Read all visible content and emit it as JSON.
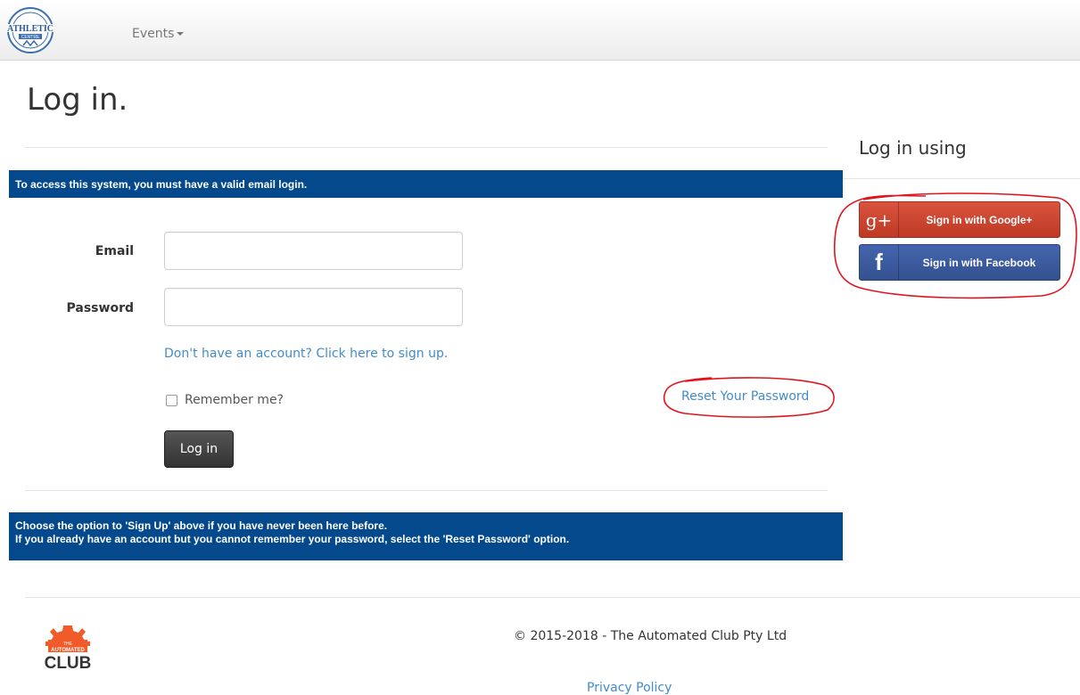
{
  "navbar": {
    "logo_text": "ATHLETIC",
    "logo_sub": "CENTRE",
    "events_label": "Events"
  },
  "page": {
    "title": "Log in.",
    "side_title": "Log in using"
  },
  "banners": {
    "top": "To access this system, you must have a valid email login.",
    "bottom_line1": "Choose the option to 'Sign Up' above if you have never been here before.",
    "bottom_line2": "If you already have an account but you cannot remember your password, select the 'Reset Password' option."
  },
  "form": {
    "email_label": "Email",
    "email_value": "",
    "password_label": "Password",
    "password_value": "",
    "signup_link": "Don't have an account? Click here to sign up.",
    "remember_label": "Remember me?",
    "reset_link": "Reset Your Password",
    "login_button": "Log in"
  },
  "social": {
    "google_icon": "g+",
    "google_label": "Sign in with Google+",
    "facebook_icon": "f",
    "facebook_label": "Sign in with Facebook"
  },
  "footer": {
    "club_logo_top": "THE",
    "club_logo_mid": "AUTOMATED",
    "club_logo_bottom": "CLUB",
    "copyright": "© 2015-2018 - The Automated Club Pty Ltd",
    "privacy": "Privacy Policy"
  },
  "colors": {
    "banner": "#03498c",
    "google": "#cd4630",
    "facebook": "#3b5998",
    "link": "#428bca",
    "annotation": "#e0141e",
    "club_orange": "#f15a29"
  }
}
